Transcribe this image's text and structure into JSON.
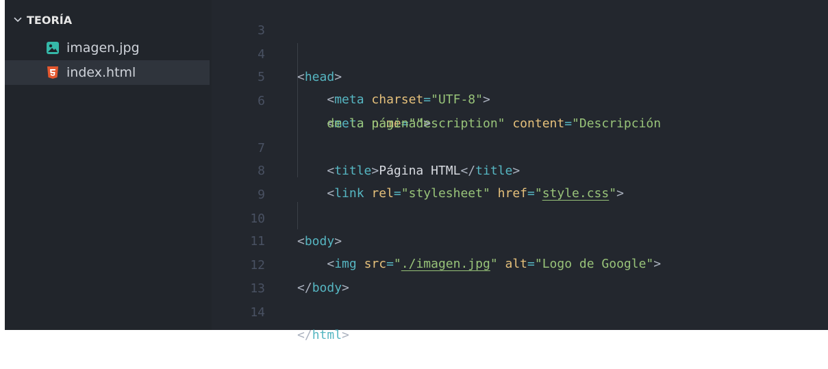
{
  "explorer": {
    "section_title": "TEORÍA",
    "files": [
      {
        "name": "imagen.jpg",
        "icon": "image-file-icon",
        "selected": false
      },
      {
        "name": "index.html",
        "icon": "html5-file-icon",
        "selected": true
      }
    ]
  },
  "editor": {
    "lines": [
      {
        "num": "3",
        "text": ""
      },
      {
        "num": "4",
        "text": "<head>"
      },
      {
        "num": "5",
        "text": "    <meta charset=\"UTF-8\">"
      },
      {
        "num": "6",
        "text": "    <meta name=\"description\" content=\"Descripción"
      },
      {
        "num": "",
        "text": "    de la página\">"
      },
      {
        "num": "7",
        "text": "    <title>Página HTML</title>"
      },
      {
        "num": "8",
        "text": "    <link rel=\"stylesheet\" href=\"style.css\">"
      },
      {
        "num": "9",
        "text": ""
      },
      {
        "num": "10",
        "text": "<body>"
      },
      {
        "num": "11",
        "text": "    <img src=\"./imagen.jpg\" alt=\"Logo de Google\">"
      },
      {
        "num": "12",
        "text": "</body>"
      },
      {
        "num": "13",
        "text": ""
      },
      {
        "num": "14",
        "text": "</html>"
      }
    ]
  },
  "colors": {
    "background": "#23272e",
    "sidebar": "#21252b",
    "tag": "#56b6c2",
    "attribute": "#d19a66",
    "string": "#98c379",
    "line_number": "#495162"
  }
}
